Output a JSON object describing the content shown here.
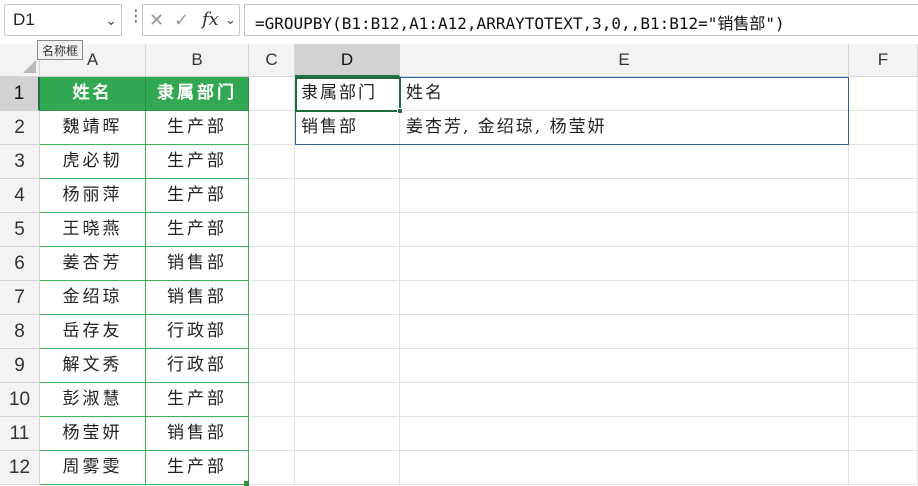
{
  "name_box": {
    "value": "D1",
    "tooltip": "名称框"
  },
  "formula_bar": {
    "cancel_icon": "x-icon",
    "enter_icon": "check-icon",
    "fx_label": "fx",
    "formula": "=GROUPBY(B1:B12,A1:A12,ARRAYTOTEXT,3,0,,B1:B12=\"销售部\")"
  },
  "columns": [
    "A",
    "B",
    "C",
    "D",
    "E",
    "F"
  ],
  "selected_column": "D",
  "rows": [
    "1",
    "2",
    "3",
    "4",
    "5",
    "6",
    "7",
    "8",
    "9",
    "10",
    "11",
    "12"
  ],
  "selected_row": "1",
  "source_table": {
    "headers": [
      "姓名",
      "隶属部门"
    ],
    "rows": [
      [
        "魏靖晖",
        "生产部"
      ],
      [
        "虎必韧",
        "生产部"
      ],
      [
        "杨丽萍",
        "生产部"
      ],
      [
        "王晓燕",
        "生产部"
      ],
      [
        "姜杏芳",
        "销售部"
      ],
      [
        "金绍琼",
        "销售部"
      ],
      [
        "岳存友",
        "行政部"
      ],
      [
        "解文秀",
        "行政部"
      ],
      [
        "彭淑慧",
        "生产部"
      ],
      [
        "杨莹妍",
        "销售部"
      ],
      [
        "周雾雯",
        "生产部"
      ]
    ]
  },
  "result": {
    "header": [
      "隶属部门",
      "姓名"
    ],
    "row": [
      "销售部",
      "姜杏芳, 金绍琼, 杨莹妍"
    ]
  },
  "colors": {
    "header_green": "#33a852",
    "selection_green": "#1f6b3c",
    "output_border": "#2e5f9e"
  }
}
